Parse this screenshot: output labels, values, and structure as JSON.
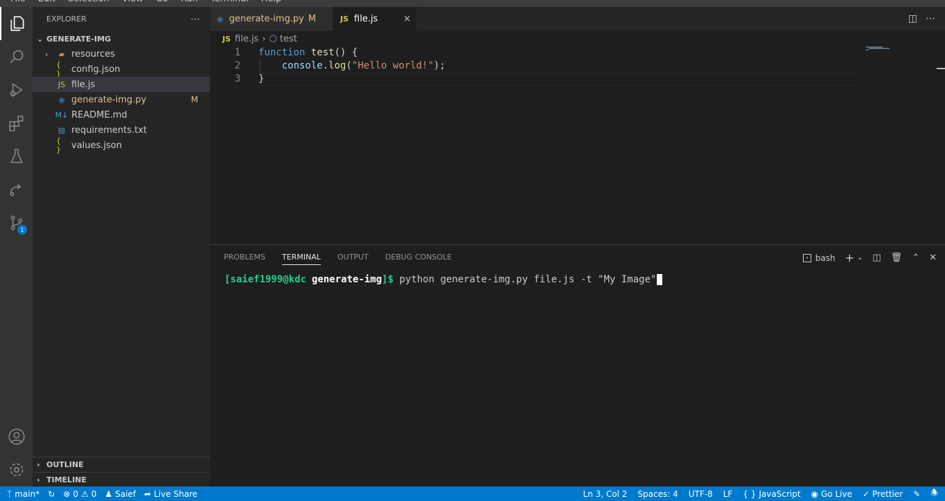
{
  "menubar": [
    "File",
    "Edit",
    "Selection",
    "View",
    "Go",
    "Run",
    "Terminal",
    "Help"
  ],
  "sidebar": {
    "title": "EXPLORER",
    "more": "⋯",
    "folder": "GENERATE-IMG",
    "items": [
      {
        "label": "resources",
        "icon": "▰",
        "icon_color": "#c09553"
      },
      {
        "label": "config.json",
        "icon": "{ }",
        "icon_color": "#cbcb41"
      },
      {
        "label": "file.js",
        "icon": "JS",
        "icon_color": "#cbcb41"
      },
      {
        "label": "generate-img.py",
        "icon": "◉",
        "icon_color": "#3572a5",
        "decoration": "M"
      },
      {
        "label": "README.md",
        "icon": "M↓",
        "icon_color": "#519aba"
      },
      {
        "label": "requirements.txt",
        "icon": "▤",
        "icon_color": "#519aba"
      },
      {
        "label": "values.json",
        "icon": "{ }",
        "icon_color": "#cbcb41"
      }
    ],
    "outline": "OUTLINE",
    "timeline": "TIMELINE"
  },
  "tabs": [
    {
      "label": "generate-img.py",
      "icon": "◉",
      "mark": "M"
    },
    {
      "label": "file.js",
      "icon": "JS",
      "close": "×"
    }
  ],
  "breadcrumb": {
    "icon": "JS",
    "file": "file.js",
    "separator": "›",
    "symbol_icon": "⬡",
    "symbol": "test"
  },
  "editor": {
    "line_numbers": [
      "1",
      "2",
      "3"
    ],
    "lines": [
      [
        {
          "t": "function",
          "c": "kw"
        },
        {
          "t": " ",
          "c": "pl"
        },
        {
          "t": "test",
          "c": "fn"
        },
        {
          "t": "() {",
          "c": "pl"
        }
      ],
      [
        {
          "t": "    ",
          "c": "pl"
        },
        {
          "t": "console",
          "c": "var"
        },
        {
          "t": ".",
          "c": "pl"
        },
        {
          "t": "log",
          "c": "fn"
        },
        {
          "t": "(",
          "c": "pl"
        },
        {
          "t": "\"Hello world!\"",
          "c": "str"
        },
        {
          "t": ");",
          "c": "pl"
        }
      ],
      [
        {
          "t": "}",
          "c": "pl"
        }
      ]
    ]
  },
  "panel": {
    "tabs": [
      "PROBLEMS",
      "TERMINAL",
      "OUTPUT",
      "DEBUG CONSOLE"
    ],
    "active_tab": "TERMINAL",
    "shell": "bash",
    "prompt_user": "[saief1999@kdc",
    "prompt_dir": "generate-img",
    "prompt_end": "]$",
    "command": " python generate-img.py file.js -t \"My Image\""
  },
  "statusbar": {
    "branch": "main*",
    "errors": "0",
    "warnings": "0",
    "user": "Saief",
    "live_share": "Live Share",
    "position": "Ln 3, Col 2",
    "spaces": "Spaces: 4",
    "encoding": "UTF-8",
    "eol": "LF",
    "language": "JavaScript",
    "go_live": "Go Live",
    "prettier": "Prettier"
  },
  "activity_badge": "1",
  "colors": {
    "accent": "#007acc",
    "modified": "#e2c08d",
    "terminal_green": "#23d18b"
  }
}
